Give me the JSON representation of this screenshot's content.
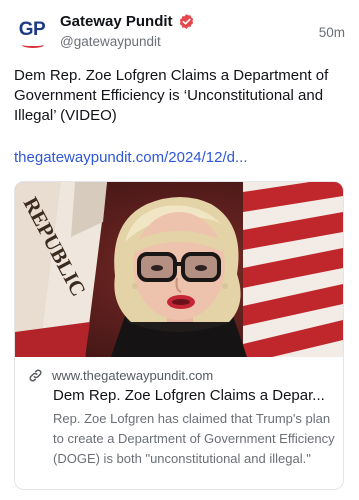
{
  "author": {
    "avatar_text": "GP",
    "display_name": "Gateway Pundit",
    "handle": "@gatewaypundit",
    "verified": true,
    "verified_icon": "verified-badge-icon"
  },
  "post": {
    "time_ago": "50m",
    "text": "Dem Rep. Zoe Lofgren Claims a Department of Government Efficiency is ‘Unconstitutional and Illegal’ (VIDEO)",
    "link": "thegatewaypundit.com/2024/12/d..."
  },
  "link_card": {
    "image_text": "REPUBLIC",
    "domain": "www.thegatewaypundit.com",
    "title": "Dem Rep. Zoe Lofgren Claims a Depar...",
    "description": "Rep. Zoe Lofgren has claimed that Trump's plan to create a Department of Government Efficiency (DOGE) is both \"unconstitutional and illegal.\""
  },
  "colors": {
    "link": "#2f57d8",
    "verified_badge": "#e5484d",
    "brand_blue": "#1f3b83",
    "brand_red": "#d9313a"
  }
}
